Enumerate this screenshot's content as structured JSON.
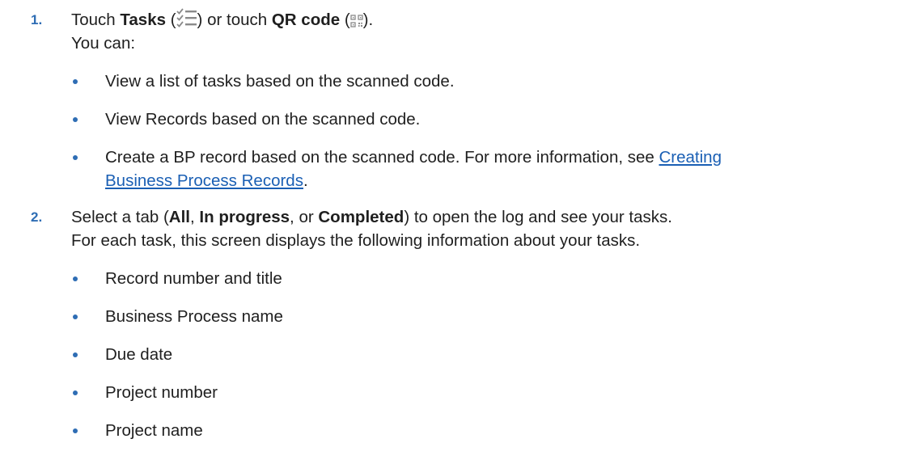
{
  "steps": [
    {
      "number": "1.",
      "line1": {
        "pre": "Touch ",
        "tasks": "Tasks",
        "open1": " (",
        "close1": ") or touch ",
        "qr": "QR code",
        "open2": " (",
        "close2": ")."
      },
      "line2": "You can:",
      "bullets": [
        {
          "text": "View a list of tasks based on the scanned code."
        },
        {
          "text": "View Records based on the scanned code."
        },
        {
          "text": "Create a BP record based on the scanned code. For more information, see ",
          "link_line1": "Creating",
          "link_line2": "Business Process Records",
          "after": "."
        }
      ]
    },
    {
      "number": "2.",
      "line1": {
        "pre": "Select a tab (",
        "all": "All",
        "sep1": ", ",
        "inprogress": "In progress",
        "sep2": ", or ",
        "completed": "Completed",
        "post": ") to open the log and see your tasks."
      },
      "line2": "For each task, this screen displays the following information about your tasks.",
      "bullets": [
        {
          "text": "Record number and title"
        },
        {
          "text": "Business Process name"
        },
        {
          "text": "Due date"
        },
        {
          "text": "Project number"
        },
        {
          "text": "Project name"
        }
      ]
    }
  ],
  "icons": {
    "tasks": "tasks-checklist-icon",
    "qr": "qr-code-icon"
  },
  "colors": {
    "accent": "#2e6db4",
    "link": "#1a5fb4",
    "text": "#1f1f1f"
  }
}
